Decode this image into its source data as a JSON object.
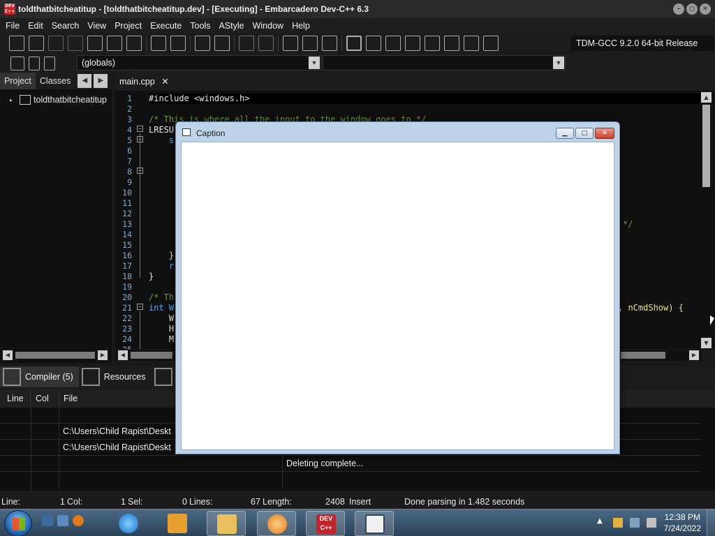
{
  "window": {
    "title": "toldthatbitcheatitup - [toldthatbitcheatitup.dev] - [Executing] - Embarcadero Dev-C++ 6.3",
    "app_icon_label": "DEV C++"
  },
  "menu": [
    "File",
    "Edit",
    "Search",
    "View",
    "Project",
    "Execute",
    "Tools",
    "AStyle",
    "Window",
    "Help"
  ],
  "toolbar": {
    "compiler": "TDM-GCC 9.2.0 64-bit Release",
    "scope_select": "(globals)"
  },
  "left_panel": {
    "tabs": [
      "Project",
      "Classes"
    ],
    "active_tab": "Project",
    "tree_root": "toldthatbitcheatitup"
  },
  "editor": {
    "tab_label": "main.cpp",
    "line_numbers": [
      "1",
      "2",
      "3",
      "4",
      "5",
      "6",
      "7",
      "8",
      "9",
      "10",
      "11",
      "12",
      "13",
      "14",
      "15",
      "16",
      "17",
      "18",
      "19",
      "20",
      "21",
      "22",
      "23",
      "24",
      "25"
    ],
    "lines": [
      "#include <windows.h>",
      "",
      "/* This is where all the input to the window goes to */",
      "LRESU",
      "    s",
      "",
      "",
      "",
      "",
      "",
      "",
      "",
      "",
      "",
      "",
      "    }",
      "    r",
      "}",
      "",
      "/* Th",
      "int W",
      "    W",
      "    H",
      "    M",
      ""
    ],
    "right_fragments": {
      "line13": "*/",
      "line21": ", nCmdShow) {"
    }
  },
  "bottom_panel": {
    "tabs": [
      "Compiler (5)",
      "Resources"
    ],
    "active_tab": "Compiler (5)",
    "columns": [
      "Line",
      "Col",
      "File"
    ],
    "rows": [
      {
        "line": "",
        "col": "",
        "file": "",
        "message": ""
      },
      {
        "line": "",
        "col": "",
        "file": "C:\\Users\\Child Rapist\\Deskt",
        "message": ""
      },
      {
        "line": "",
        "col": "",
        "file": "C:\\Users\\Child Rapist\\Deskt",
        "message": ""
      },
      {
        "line": "",
        "col": "",
        "file": "",
        "message": "Deleting complete..."
      }
    ]
  },
  "statusbar": {
    "line_label": "Line:",
    "line_value": "1",
    "col_label": "Col:",
    "col_value": "1",
    "sel_label": "Sel:",
    "sel_value": "0",
    "lines_label": "Lines:",
    "lines_value": "67",
    "length_label": "Length:",
    "length_value": "2408",
    "mode": "Insert",
    "message": "Done parsing in 1.482 seconds"
  },
  "caption_window": {
    "title": "Caption"
  },
  "taskbar": {
    "time": "12:38 PM",
    "date": "7/24/2022",
    "devcpp_label": "DEV C++"
  },
  "colors": {
    "comment": "#6b9e3c",
    "keyword": "#5aa6e6",
    "line_number": "#7fb0d8",
    "ide_background": "#101010"
  }
}
